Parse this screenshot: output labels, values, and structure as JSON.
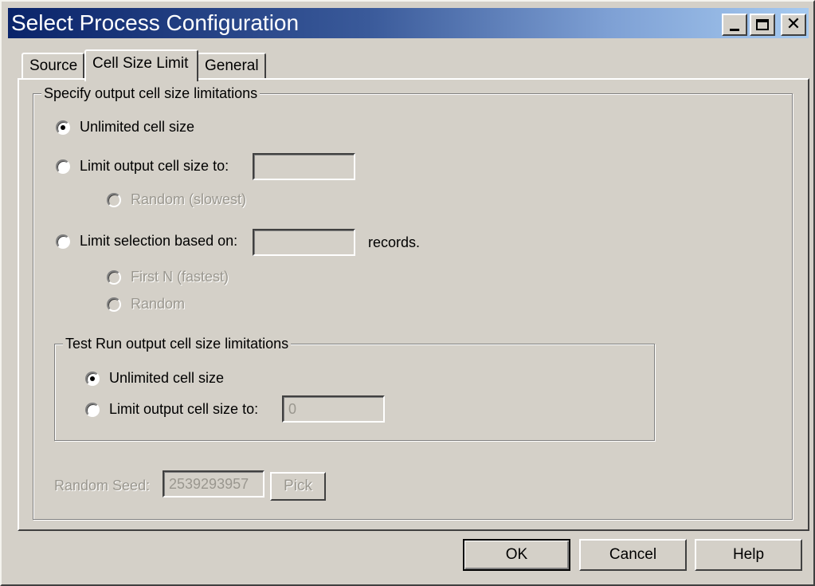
{
  "window": {
    "title": "Select Process Configuration",
    "controls": [
      "minimize",
      "maximize",
      "close"
    ]
  },
  "tabs": [
    {
      "label": "Source",
      "active": false
    },
    {
      "label": "Cell Size Limit",
      "active": true
    },
    {
      "label": "General",
      "active": false
    }
  ],
  "output_group": {
    "legend": "Specify output cell size limitations",
    "options": {
      "unlimited": {
        "label": "Unlimited cell size",
        "checked": true,
        "enabled": true
      },
      "limit_size": {
        "label": "Limit output cell size to:",
        "checked": false,
        "enabled": true,
        "value": ""
      },
      "random_slowest": {
        "label": "Random (slowest)",
        "checked": false,
        "enabled": false
      },
      "limit_selection": {
        "label": "Limit selection based on:",
        "checked": false,
        "enabled": true,
        "value": "",
        "suffix": "records."
      },
      "first_n": {
        "label": "First N (fastest)",
        "checked": false,
        "enabled": false
      },
      "random": {
        "label": "Random",
        "checked": false,
        "enabled": false
      }
    }
  },
  "test_run_group": {
    "legend": "Test Run output cell size limitations",
    "options": {
      "unlimited": {
        "label": "Unlimited cell size",
        "checked": true,
        "enabled": true
      },
      "limit_size": {
        "label": "Limit output cell size to:",
        "checked": false,
        "enabled": true,
        "value": "0"
      }
    }
  },
  "random_seed": {
    "label": "Random Seed:",
    "value": "2539293957",
    "pick_label": "Pick",
    "enabled": false
  },
  "buttons": {
    "ok": "OK",
    "cancel": "Cancel",
    "help": "Help"
  },
  "icons": {
    "minimize": "minimize-icon",
    "maximize": "maximize-icon",
    "close": "close-icon"
  }
}
